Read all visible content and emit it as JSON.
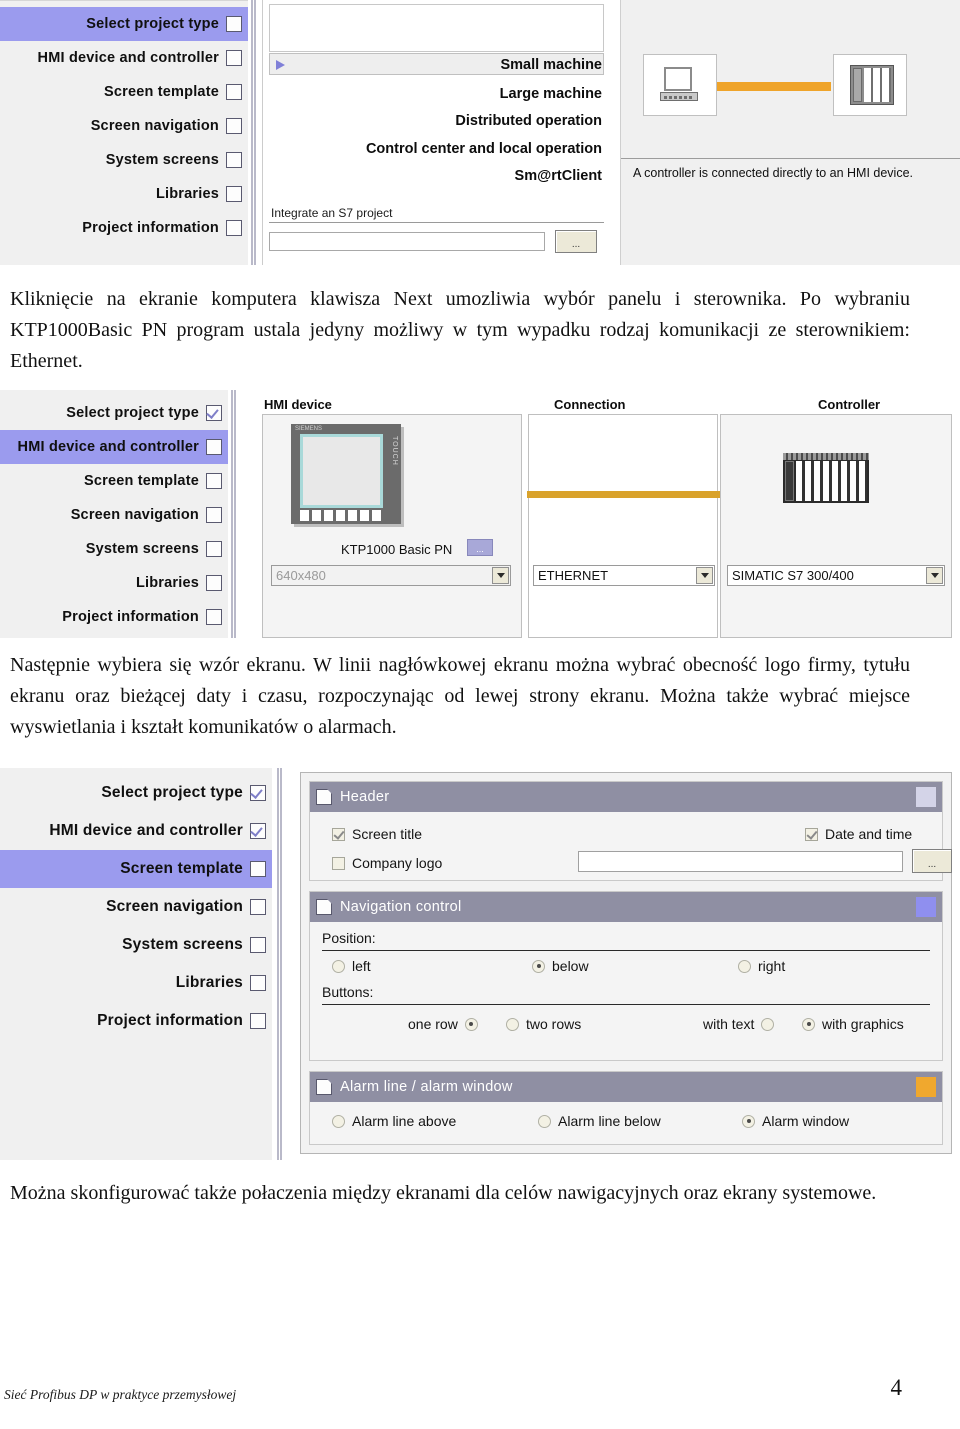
{
  "document": {
    "footer_left": "Sieć Profibus DP w praktyce przemysłowej",
    "page_number": "4"
  },
  "paragraphs": {
    "p1": "Kliknięcie na ekranie komputera klawisza Next umozliwia wybór panelu i sterownika. Po wybraniu KTP1000Basic PN program ustala jedyny możliwy w tym wypadku rodzaj komunikacji ze sterownikiem: Ethernet.",
    "p2": "Następnie wybiera się wzór ekranu. W linii nagłówkowej ekranu można wybrać obecność logo firmy, tytułu ekranu oraz bieżącej daty i czasu, rozpoczynając od lewej strony ekranu. Można także wybrać miejsce wyswietlania i kształt komunikatów o alarmach.",
    "p3": "Można skonfigurować także połaczenia między ekranami dla celów nawigacyjnych oraz ekrany systemowe."
  },
  "wizard_steps": [
    {
      "label": "Select project type"
    },
    {
      "label": "HMI device and controller"
    },
    {
      "label": "Screen template"
    },
    {
      "label": "Screen navigation"
    },
    {
      "label": "System screens"
    },
    {
      "label": "Libraries"
    },
    {
      "label": "Project information"
    }
  ],
  "screenshot1": {
    "project_types": [
      "Small machine",
      "Large machine",
      "Distributed operation",
      "Control center and local operation",
      "Sm@rtClient"
    ],
    "selected_project_type": "Small machine",
    "integrate_label": "Integrate an S7 project",
    "integrate_value": "",
    "browse_button": "...",
    "diagram_caption": "A controller is connected directly to an HMI device.",
    "link_color": "#efa42a"
  },
  "screenshot2": {
    "columns": {
      "hmi_device": "HMI device",
      "connection": "Connection",
      "controller": "Controller"
    },
    "device_name": "KTP1000 Basic PN",
    "device_browse_button": "...",
    "resolution": "640x480",
    "connection_type": "ETHERNET",
    "controller_type": "SIMATIC S7 300/400",
    "touch_label": "TOUCH",
    "link_color": "#d9a22b"
  },
  "screenshot3": {
    "groups": [
      {
        "title": "Header",
        "badge_color": "#d4d4e8",
        "options": [
          {
            "label": "Screen title",
            "checked": true
          },
          {
            "label": "Company logo",
            "checked": false
          },
          {
            "label": "Date and time",
            "checked": true
          }
        ],
        "logo_path_value": "",
        "browse_button": "..."
      },
      {
        "title": "Navigation control",
        "badge_color": "#8f8fef",
        "position_label": "Position:",
        "position_options": [
          {
            "label": "left",
            "selected": false
          },
          {
            "label": "below",
            "selected": true
          },
          {
            "label": "right",
            "selected": false
          }
        ],
        "buttons_label": "Buttons:",
        "rows_options": [
          {
            "label": "one row",
            "selected": true
          },
          {
            "label": "two rows",
            "selected": false
          }
        ],
        "style_options": [
          {
            "label": "with text",
            "selected": false
          },
          {
            "label": "with graphics",
            "selected": true
          }
        ]
      },
      {
        "title": "Alarm line / alarm window",
        "badge_color": "#f0a82e",
        "alarm_options": [
          {
            "label": "Alarm line above",
            "selected": false
          },
          {
            "label": "Alarm line below",
            "selected": false
          },
          {
            "label": "Alarm window",
            "selected": true
          }
        ]
      }
    ]
  }
}
